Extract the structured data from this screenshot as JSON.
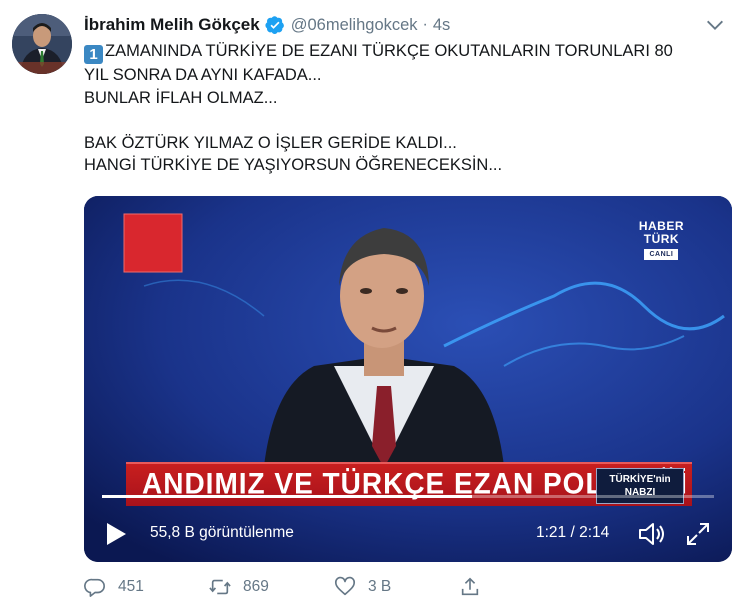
{
  "tweet": {
    "author_name": "İbrahim Melih Gökçek",
    "handle": "@06melihgokcek",
    "separator": "·",
    "time": "4s",
    "lines": [
      "ZAMANINDA TÜRKİYE DE EZANI TÜRKÇE OKUTANLARIN TORUNLARI 80",
      "YIL SONRA DA AYNI KAFADA...",
      "BUNLAR İFLAH OLMAZ...",
      "",
      "BAK ÖZTÜRK YILMAZ O İŞLER GERİDE KALDI...",
      "HANGİ TÜRKİYE DE YAŞIYORSUN ÖĞRENECEKSİN..."
    ],
    "keycap": "1"
  },
  "video": {
    "channel_logo_line1": "HABER",
    "channel_logo_line2": "TÜRK",
    "channel_logo_live": "CANLI",
    "lower_third_title": "ANDIMIZ VE TÜRKÇE EZAN POLEMİĞİ",
    "lower_third_box_line1": "TÜRKİYE'nin",
    "lower_third_box_line2": "NABZI",
    "views": "55,8 B görüntülenme",
    "current_time": "1:21",
    "time_separator": " / ",
    "duration": "2:14",
    "progress": 0.604
  },
  "actions": {
    "reply_count": "451",
    "retweet_count": "869",
    "like_count": "3 B"
  },
  "colors": {
    "verified": "#1da1f2",
    "secondary_text": "#657786",
    "keycap": "#3b88c3"
  }
}
